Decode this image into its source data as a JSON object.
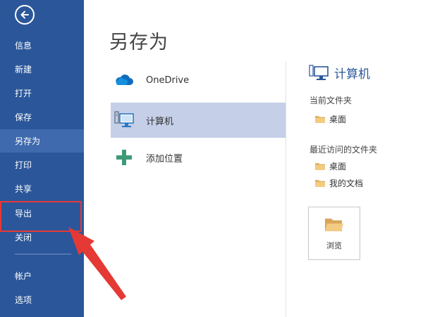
{
  "sidebar": {
    "back_icon": "back-arrow-icon",
    "items": [
      {
        "label": "信息"
      },
      {
        "label": "新建"
      },
      {
        "label": "打开"
      },
      {
        "label": "保存"
      },
      {
        "label": "另存为"
      },
      {
        "label": "打印"
      },
      {
        "label": "共享"
      },
      {
        "label": "导出"
      },
      {
        "label": "关闭"
      },
      {
        "label": "帐户"
      },
      {
        "label": "选项"
      }
    ],
    "active_item": "另存为",
    "bg_color": "#2b579a",
    "active_color": "#3f6aae"
  },
  "main": {
    "title": "另存为",
    "locations": [
      {
        "label": "OneDrive",
        "icon": "cloud-icon"
      },
      {
        "label": "计算机",
        "icon": "computer-icon",
        "selected": true
      },
      {
        "label": "添加位置",
        "icon": "plus-icon"
      }
    ]
  },
  "right_panel": {
    "title": "计算机",
    "current_folder_label": "当前文件夹",
    "current_folders": [
      {
        "label": "桌面"
      }
    ],
    "recent_folder_label": "最近访问的文件夹",
    "recent_folders": [
      {
        "label": "桌面"
      },
      {
        "label": "我的文档"
      }
    ],
    "browse_label": "浏览"
  },
  "annotation": {
    "highlight_color": "#e53935",
    "highlighted_item": "导出"
  }
}
